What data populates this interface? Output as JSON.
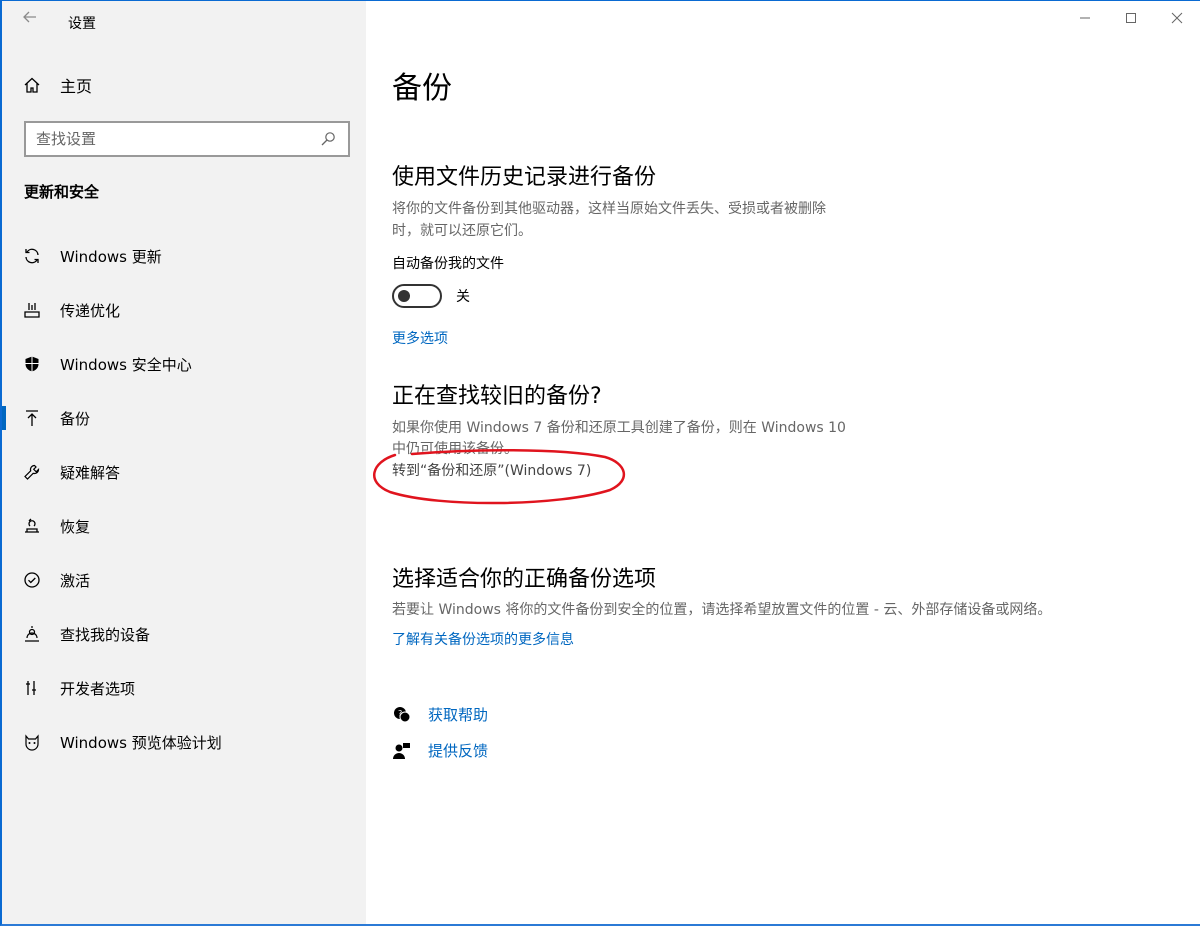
{
  "window": {
    "title": "设置"
  },
  "sidebar": {
    "home_label": "主页",
    "search_placeholder": "查找设置",
    "section_title": "更新和安全",
    "items": [
      {
        "label": "Windows 更新",
        "icon": "refresh-icon"
      },
      {
        "label": "传递优化",
        "icon": "delivery-icon"
      },
      {
        "label": "Windows 安全中心",
        "icon": "shield-icon"
      },
      {
        "label": "备份",
        "icon": "backup-arrow-icon",
        "active": true
      },
      {
        "label": "疑难解答",
        "icon": "wrench-icon"
      },
      {
        "label": "恢复",
        "icon": "recovery-icon"
      },
      {
        "label": "激活",
        "icon": "check-circle-icon"
      },
      {
        "label": "查找我的设备",
        "icon": "person-find-icon"
      },
      {
        "label": "开发者选项",
        "icon": "developer-icon"
      },
      {
        "label": "Windows 预览体验计划",
        "icon": "insider-cat-icon"
      }
    ]
  },
  "main": {
    "page_title": "备份",
    "file_history": {
      "heading": "使用文件历史记录进行备份",
      "desc_line1": "将你的文件备份到其他驱动器，这样当原始文件丢失、受损或者被删除",
      "desc_line2": "时，就可以还原它们。",
      "auto_label": "自动备份我的文件",
      "toggle_state": "关",
      "toggle_on": false,
      "more_options": "更多选项"
    },
    "older_backup": {
      "heading": "正在查找较旧的备份?",
      "desc_line1": "如果你使用 Windows 7 备份和还原工具创建了备份，则在 Windows 10",
      "desc_line2": "中仍可使用该备份。",
      "goto_link": "转到“备份和还原”(Windows 7)"
    },
    "choose_option": {
      "heading": "选择适合你的正确备份选项",
      "desc": "若要让 Windows 将你的文件备份到安全的位置，请选择希望放置文件的位置 - 云、外部存储设备或网络。",
      "learn_more": "了解有关备份选项的更多信息"
    },
    "help": {
      "get_help": "获取帮助",
      "feedback": "提供反馈"
    }
  },
  "colors": {
    "accent": "#0067c0",
    "annotation": "#e0141e",
    "sidebar_bg": "#f2f2f2"
  }
}
